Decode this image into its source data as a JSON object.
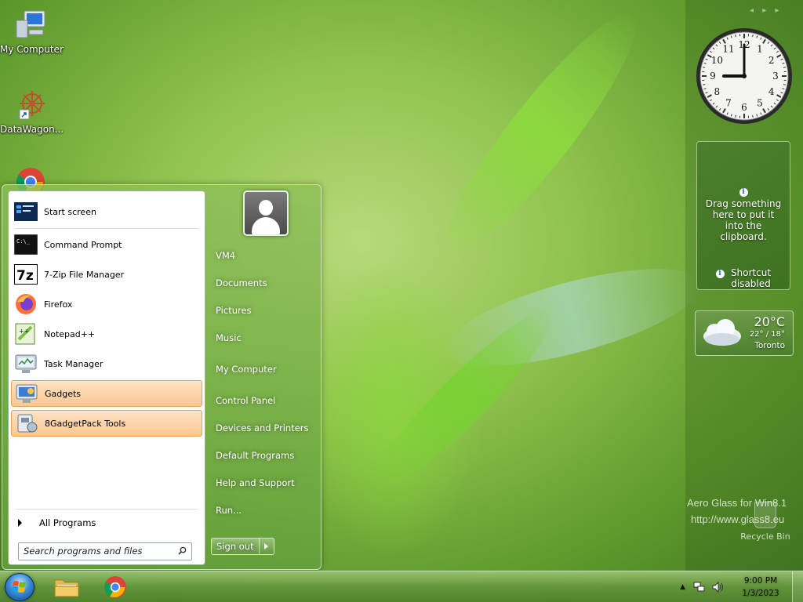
{
  "desktop": {
    "icons": [
      {
        "label": "My Computer",
        "icon": "my-computer-icon"
      },
      {
        "label": "DataWagon...",
        "icon": "datawagon-icon"
      },
      {
        "label": "",
        "icon": "chrome-icon"
      }
    ]
  },
  "start_menu": {
    "programs": [
      {
        "label": "Start screen",
        "icon": "start-screen-icon"
      },
      {
        "label": "Command Prompt",
        "icon": "command-prompt-icon"
      },
      {
        "label": "7-Zip File Manager",
        "icon": "7zip-icon"
      },
      {
        "label": "Firefox",
        "icon": "firefox-icon"
      },
      {
        "label": "Notepad++",
        "icon": "notepad-plus-plus-icon"
      },
      {
        "label": "Task Manager",
        "icon": "task-manager-icon"
      },
      {
        "label": "Gadgets",
        "icon": "gadgets-icon",
        "highlighted": true
      },
      {
        "label": "8GadgetPack Tools",
        "icon": "gadgetpack-tools-icon",
        "highlighted": true
      }
    ],
    "all_programs": "All Programs",
    "search_placeholder": "Search programs and files",
    "user_links": [
      "VM4",
      "Documents",
      "Pictures",
      "Music",
      "My Computer",
      "Control Panel",
      "Devices and Printers",
      "Default Programs",
      "Help and Support",
      "Run..."
    ],
    "sign_out": "Sign out"
  },
  "gadgets": {
    "clock": {
      "hour": 9,
      "minute": 0,
      "numbers": [
        "12",
        "1",
        "2",
        "3",
        "4",
        "5",
        "6",
        "7",
        "8",
        "9",
        "10",
        "11"
      ]
    },
    "clipboard": {
      "message": "Drag something here to put it into the clipboard.",
      "status": "Shortcut disabled"
    },
    "weather": {
      "temp": "20°C",
      "range": "22° / 18°",
      "city": "Toronto"
    }
  },
  "watermark": {
    "line1": "Aero Glass for Win8.1",
    "line2": "http://www.glass8.eu"
  },
  "recycle_bin": {
    "label": "Recycle Bin"
  },
  "taskbar": {
    "pinned": [
      {
        "name": "start-orb",
        "icon": "windows-logo-icon"
      },
      {
        "name": "explorer",
        "icon": "folder-icon"
      },
      {
        "name": "chrome",
        "icon": "chrome-icon"
      }
    ],
    "time": "9:00 PM",
    "date": "1/3/2023"
  },
  "colors": {
    "highlight": "#fbc891",
    "accent_green": "#6aa53a"
  }
}
